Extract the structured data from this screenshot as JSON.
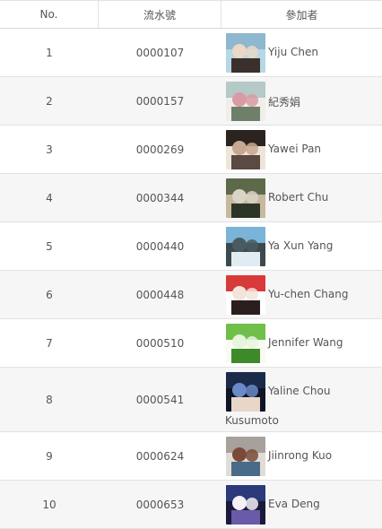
{
  "header": {
    "no": "No.",
    "serial": "流水號",
    "participant": "參加者"
  },
  "rows": [
    {
      "no": "1",
      "serial": "0000107",
      "name": "Yiju Chen",
      "avatar": "avatar-couple-selfie-icon",
      "colors": [
        "#8fb7cf",
        "#e9d9c6",
        "#3b2f2b",
        "#b7d6e6"
      ]
    },
    {
      "no": "2",
      "serial": "0000157",
      "name": "紀秀娟",
      "avatar": "avatar-flowers-balcony-icon",
      "colors": [
        "#b5c9c7",
        "#d89aa5",
        "#6e7f6a",
        "#f0eee8"
      ]
    },
    {
      "no": "3",
      "serial": "0000269",
      "name": "Yawei Pan",
      "avatar": "avatar-portrait-dark-hair-icon",
      "colors": [
        "#2a2320",
        "#c8a890",
        "#5a4a42",
        "#efe4d8"
      ]
    },
    {
      "no": "4",
      "serial": "0000344",
      "name": "Robert Chu",
      "avatar": "avatar-outdoor-trees-icon",
      "colors": [
        "#5d6a4a",
        "#d9d4c6",
        "#2d3528",
        "#c7b8a0"
      ]
    },
    {
      "no": "5",
      "serial": "0000440",
      "name": "Ya Xun Yang",
      "avatar": "avatar-sculpture-sky-icon",
      "colors": [
        "#7ab4d8",
        "#4a5a60",
        "#e0ecf2",
        "#3c4a4f"
      ]
    },
    {
      "no": "6",
      "serial": "0000448",
      "name": "Yu-chen Chang",
      "avatar": "avatar-red-dress-smile-icon",
      "colors": [
        "#d83a3a",
        "#f2e4da",
        "#2a1e1e",
        "#ffffff"
      ]
    },
    {
      "no": "7",
      "serial": "0000510",
      "name": "Jennifer Wang",
      "avatar": "avatar-green-flowers-icon",
      "colors": [
        "#6fbf4a",
        "#e8f4dc",
        "#3e8a2a",
        "#f7fbf2"
      ]
    },
    {
      "no": "8",
      "serial": "0000541",
      "name": "Yaline Chou",
      "name2": "Kusumoto",
      "avatar": "avatar-couple-night-icon",
      "colors": [
        "#1c2a4a",
        "#6a8ac8",
        "#e8d6c8",
        "#0f1526"
      ]
    },
    {
      "no": "9",
      "serial": "0000624",
      "name": "Jiinrong Kuo",
      "avatar": "avatar-temple-gate-icon",
      "colors": [
        "#a8a09a",
        "#7a4a3a",
        "#4a6a8a",
        "#e0dcd6"
      ]
    },
    {
      "no": "10",
      "serial": "0000653",
      "name": "Eva Deng",
      "avatar": "avatar-wedding-couple-icon",
      "colors": [
        "#2a3a7a",
        "#f4f0f6",
        "#6a5aa8",
        "#1a1a3a"
      ]
    }
  ]
}
